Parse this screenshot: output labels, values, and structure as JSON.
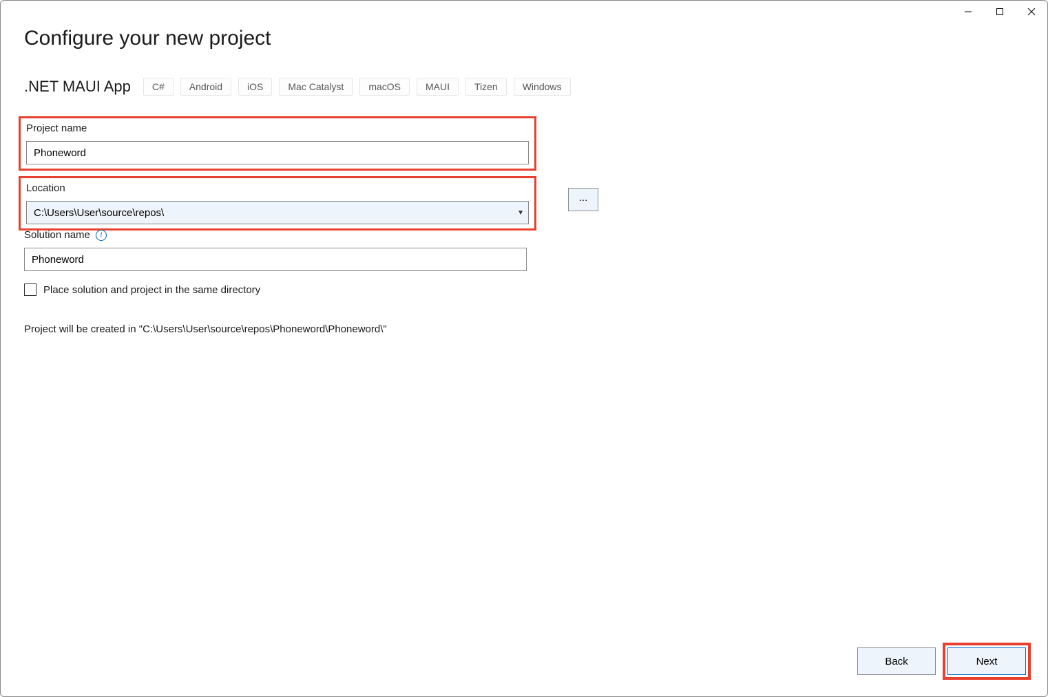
{
  "titlebar": {
    "minimize": "Minimize",
    "maximize": "Maximize",
    "close": "Close"
  },
  "page_title": "Configure your new project",
  "template_name": ".NET MAUI App",
  "tags": [
    "C#",
    "Android",
    "iOS",
    "Mac Catalyst",
    "macOS",
    "MAUI",
    "Tizen",
    "Windows"
  ],
  "fields": {
    "project_name": {
      "label": "Project name",
      "value": "Phoneword"
    },
    "location": {
      "label": "Location",
      "value": "C:\\Users\\User\\source\\repos\\",
      "browse": "..."
    },
    "solution_name": {
      "label": "Solution name",
      "value": "Phoneword"
    },
    "same_directory": {
      "checked": false,
      "label": "Place solution and project in the same directory"
    }
  },
  "path_info": "Project will be created in \"C:\\Users\\User\\source\\repos\\Phoneword\\Phoneword\\\"",
  "buttons": {
    "back": "Back",
    "next": "Next"
  }
}
